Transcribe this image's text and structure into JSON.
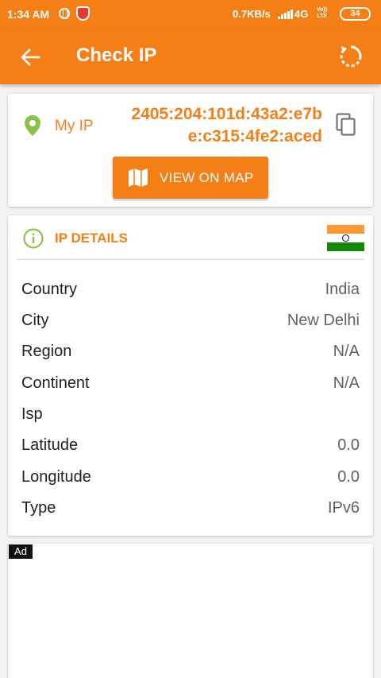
{
  "status_bar": {
    "time": "1:34 AM",
    "net_speed": "0.7KB/s",
    "network": "4G",
    "volte_top": "Vo))",
    "volte_bottom": "LTE",
    "battery": "34",
    "icons": [
      "globe-icon",
      "shield-icon",
      "signal-icon"
    ]
  },
  "app_bar": {
    "title": "Check IP",
    "back_icon": "arrow-left-icon",
    "refresh_icon": "refresh-icon"
  },
  "my_ip": {
    "label": "My IP",
    "line1": "2405:204:101d:43a2:e7b",
    "line2": "e:c315:4fe2:aced",
    "copy_icon": "copy-icon",
    "map_button_label": "VIEW ON MAP",
    "map_icon": "map-icon"
  },
  "ip_details": {
    "title": "IP DETAILS",
    "flag_country": "India",
    "rows": [
      {
        "key": "Country",
        "value": "India"
      },
      {
        "key": "City",
        "value": "New Delhi"
      },
      {
        "key": "Region",
        "value": "N/A"
      },
      {
        "key": "Continent",
        "value": "N/A"
      },
      {
        "key": "Isp",
        "value": ""
      },
      {
        "key": "Latitude",
        "value": "0.0"
      },
      {
        "key": "Longitude",
        "value": "0.0"
      },
      {
        "key": "Type",
        "value": "IPv6"
      }
    ]
  },
  "ad": {
    "badge": "Ad"
  },
  "colors": {
    "accent": "#f57f17",
    "pin_green": "#8bc34a",
    "background": "#f2f2f2"
  }
}
